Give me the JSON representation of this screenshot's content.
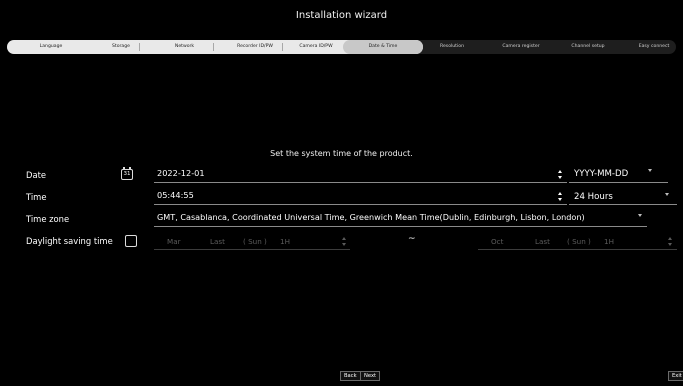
{
  "window": {
    "title": "Installation wizard"
  },
  "steps": [
    {
      "label": "Language",
      "state": "done"
    },
    {
      "label": "Storage",
      "state": "done"
    },
    {
      "label": "Network",
      "state": "done"
    },
    {
      "label": "Recorder ID/PW",
      "state": "done"
    },
    {
      "label": "Camera ID/PW",
      "state": "done"
    },
    {
      "label": "Date & Time",
      "state": "current"
    },
    {
      "label": "Resolution",
      "state": "todo"
    },
    {
      "label": "Camera register",
      "state": "todo"
    },
    {
      "label": "Channel setup",
      "state": "todo"
    },
    {
      "label": "Easy connect",
      "state": "todo"
    }
  ],
  "main": {
    "subtitle": "Set the system time of the product.",
    "date": {
      "label": "Date",
      "calendar_icon_text": "31",
      "value": "2022-12-01",
      "format": "YYYY-MM-DD"
    },
    "time": {
      "label": "Time",
      "value": "05:44:55",
      "format": "24 Hours"
    },
    "timezone": {
      "label": "Time zone",
      "value": "GMT, Casablanca, Coordinated Universal Time, Greenwich Mean Time(Dublin, Edinburgh, Lisbon, London)"
    },
    "dst": {
      "label": "Daylight saving time",
      "checked": false,
      "start": {
        "month": "Mar",
        "week": "Last",
        "day": "( Sun )",
        "hour": "1H"
      },
      "separator": "~",
      "end": {
        "month": "Oct",
        "week": "Last",
        "day": "( Sun )",
        "hour": "1H"
      }
    }
  },
  "footer": {
    "back_label": "Back",
    "next_label": "Next",
    "exit_label": "Exit"
  },
  "colors": {
    "background": "#000000",
    "step_done": "#e9e9e9",
    "step_current": "#c8c8c8",
    "step_todo": "#1e1e1e"
  }
}
